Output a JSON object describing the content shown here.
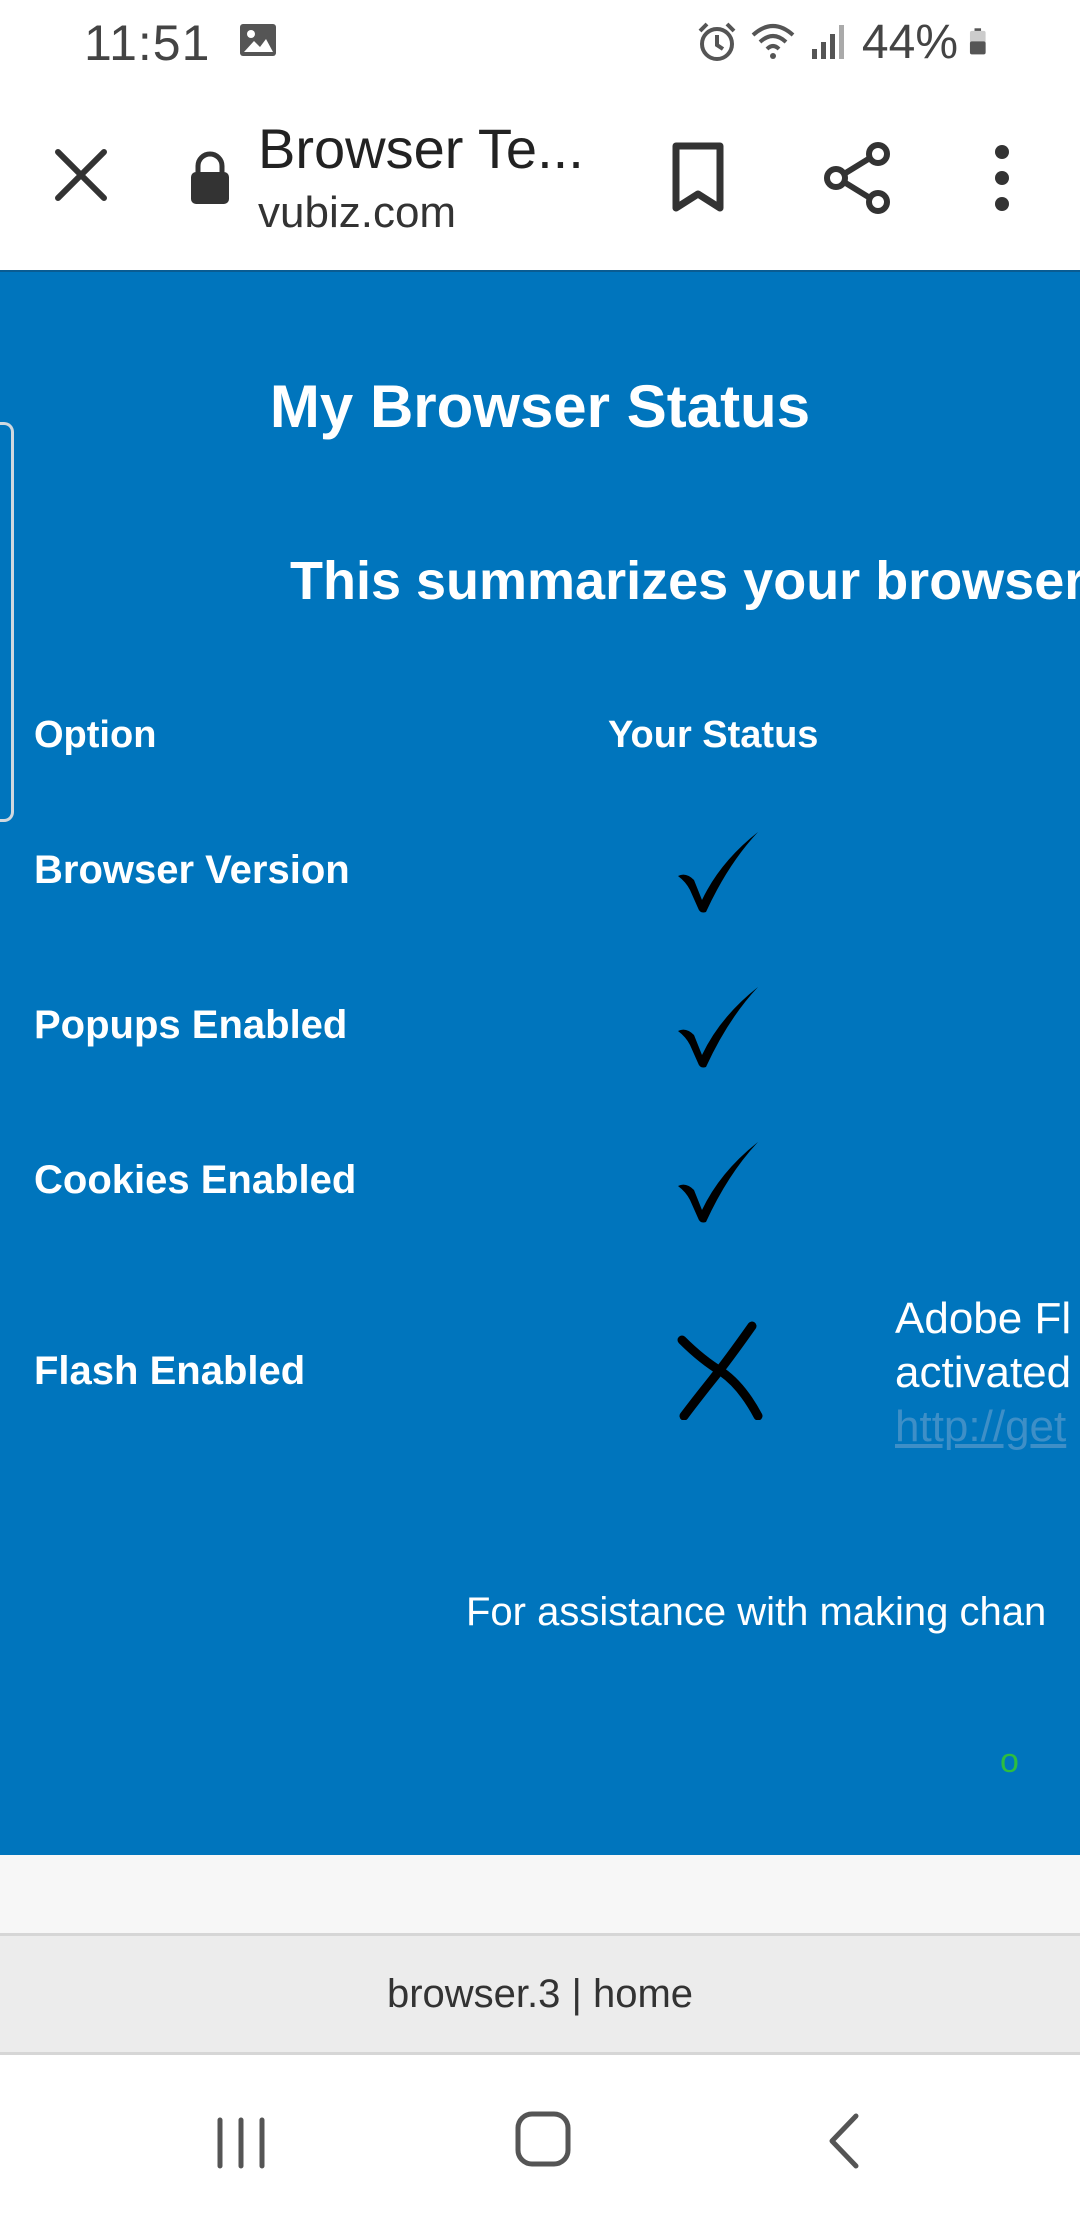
{
  "status_bar": {
    "time": "11:51",
    "battery": "44%",
    "icons": [
      "gallery-icon",
      "alarm-icon",
      "wifi-icon",
      "signal-icon",
      "battery-icon"
    ]
  },
  "browser": {
    "title": "Browser Te...",
    "url": "vubiz.com",
    "icons": [
      "close-icon",
      "lock-icon",
      "bookmark-icon",
      "share-icon",
      "more-vert-icon"
    ]
  },
  "page": {
    "title": "My Browser Status",
    "subtitle": "This summarizes your browser's",
    "columns": {
      "option": "Option",
      "status": "Your Status"
    },
    "rows": [
      {
        "label": "Browser Version",
        "status": "check"
      },
      {
        "label": "Popups Enabled",
        "status": "check"
      },
      {
        "label": "Cookies Enabled",
        "status": "check"
      },
      {
        "label": "Flash Enabled",
        "status": "cross"
      }
    ],
    "flash_note": {
      "line1": "Adobe Fl",
      "line2": "activated",
      "link": "http://get"
    },
    "assistance": "For assistance with making chan",
    "marker": "o"
  },
  "footer": {
    "text": "browser.3 | home"
  },
  "colors": {
    "page_bg": "#0075bd",
    "link": "#3e8fc7",
    "marker": "#2dbd3f"
  },
  "nav_bar": {
    "icons": [
      "recent-apps-icon",
      "home-icon",
      "back-icon"
    ]
  }
}
